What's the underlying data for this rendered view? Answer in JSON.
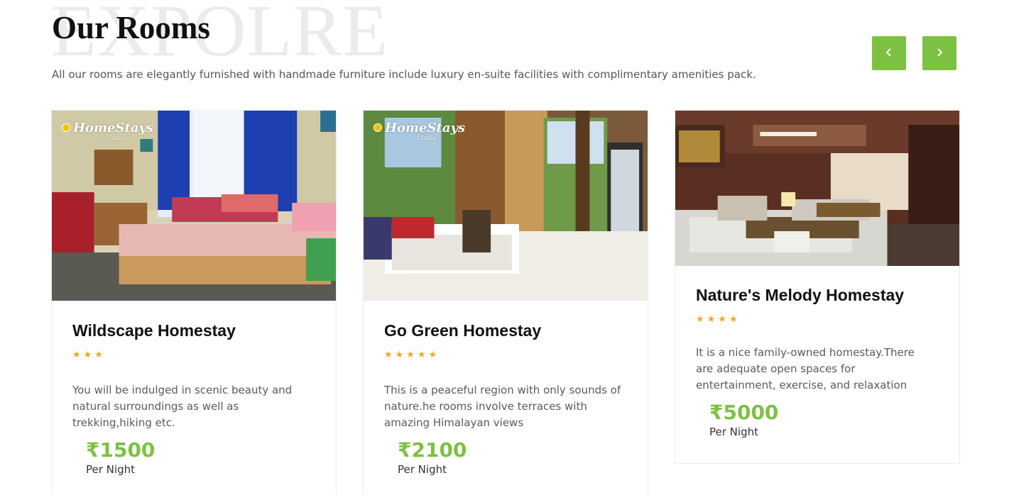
{
  "section": {
    "bg_word": "EXPOLRE",
    "title": "Our Rooms",
    "subtitle": "All our rooms are elegantly furnished with handmade furniture include luxury en-suite facilities with complimentary amenities pack."
  },
  "nav": {
    "prev_icon": "chevron-left-icon",
    "next_icon": "chevron-right-icon",
    "prev_glyph": "‹",
    "next_glyph": "›"
  },
  "watermark": {
    "brand": "HomeStays",
    "sub": "of India"
  },
  "rooms": [
    {
      "name": "Wildscape Homestay",
      "rating": 3,
      "stars": "★★★",
      "description": "You will be indulged in scenic beauty and natural surroundings as well as trekking,hiking etc.",
      "price": "₹1500",
      "price_unit": "Per Night"
    },
    {
      "name": "Go Green Homestay",
      "rating": 5,
      "stars": "★★★★★",
      "description": "This is a peaceful region with only sounds of nature.he rooms involve terraces with amazing Himalayan views",
      "price": "₹2100",
      "price_unit": "Per Night"
    },
    {
      "name": "Nature's Melody Homestay",
      "rating": 4,
      "stars": "★★★★",
      "description": "It is a nice family-owned homestay.There are adequate open spaces for entertainment, exercise, and relaxation",
      "price": "₹5000",
      "price_unit": "Per Night"
    }
  ],
  "colors": {
    "accent": "#7cc142",
    "star": "#f5a623",
    "bg_word": "#ebebeb"
  }
}
